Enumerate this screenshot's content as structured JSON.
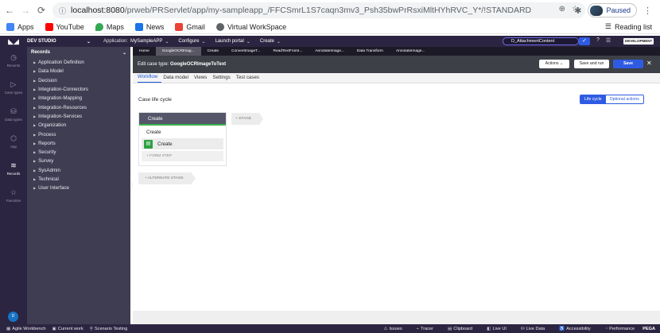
{
  "browser": {
    "url_host": "localhost:8080",
    "url_path": "/prweb/PRServlet/app/my-sampleapp_/FFCSmrL1S7caqn3mv3_Psh35bwPrRsxiMltHYhRVC_Y*/!STANDARD",
    "profile_label": "Paused",
    "bookmarks": [
      {
        "label": "Apps",
        "color": "#4285f4"
      },
      {
        "label": "YouTube",
        "color": "#ff0000"
      },
      {
        "label": "Maps",
        "color": "#34a853"
      },
      {
        "label": "News",
        "color": "#1a73e8"
      },
      {
        "label": "Gmail",
        "color": "#ea4335"
      },
      {
        "label": "Virtual WorkSpace",
        "color": "#5f6368"
      }
    ],
    "reading_list": "Reading list"
  },
  "header": {
    "studio": "DEV STUDIO",
    "application_label": "Application:",
    "application_value": "MySampleAPP",
    "configure": "Configure",
    "launch_portal": "Launch portal",
    "create": "Create",
    "search_value": "D_AttachmentContent",
    "env_badge": "DEVELOPMENT"
  },
  "rail": {
    "items": [
      {
        "label": "Recents",
        "icon": "clock-icon"
      },
      {
        "label": "Case types",
        "icon": "case-types-icon"
      },
      {
        "label": "Data types",
        "icon": "data-types-icon"
      },
      {
        "label": "App",
        "icon": "app-icon"
      },
      {
        "label": "Records",
        "icon": "records-icon"
      },
      {
        "label": "Favorites",
        "icon": "star-icon"
      }
    ],
    "avatar": "D"
  },
  "explorer": {
    "title": "Records",
    "items": [
      "Application Definition",
      "Data Model",
      "Decision",
      "Integration-Connectors",
      "Integration-Mapping",
      "Integration-Resources",
      "Integration-Services",
      "Organization",
      "Process",
      "Reports",
      "Security",
      "Survey",
      "SysAdmin",
      "Technical",
      "User Interface"
    ]
  },
  "work_tabs": [
    "Home",
    "GoogleOCRImag...",
    "Create",
    "ConvertImageT...",
    "ReadTextFromI...",
    "AnnotateImage...",
    "Data Transform",
    "AnnotateImage..."
  ],
  "case_header": {
    "title_prefix": "Edit case type:",
    "title_value": "GoogleOCRImageToText",
    "actions": "Actions",
    "save_and_run": "Save and run",
    "save": "Save"
  },
  "sub_tabs": [
    "Workflow",
    "Data model",
    "Views",
    "Settings",
    "Test cases"
  ],
  "canvas": {
    "title": "Case life cycle",
    "toggle_lifecycle": "Life cycle",
    "toggle_optional": "Optional actions",
    "stage_name": "Create",
    "process_name": "Create",
    "step_name": "Create",
    "form_step": "FORM STEP",
    "add_stage": "STAGE",
    "alternate_stage": "ALTERNATE STAGE"
  },
  "footer": {
    "left": [
      "Agile Workbench",
      "Current work",
      "Scenario Testing"
    ],
    "right": [
      "Issues",
      "Tracer",
      "Clipboard",
      "Live UI",
      "Live Data",
      "Accessibility",
      "Performance"
    ],
    "brand": "PEGA"
  }
}
